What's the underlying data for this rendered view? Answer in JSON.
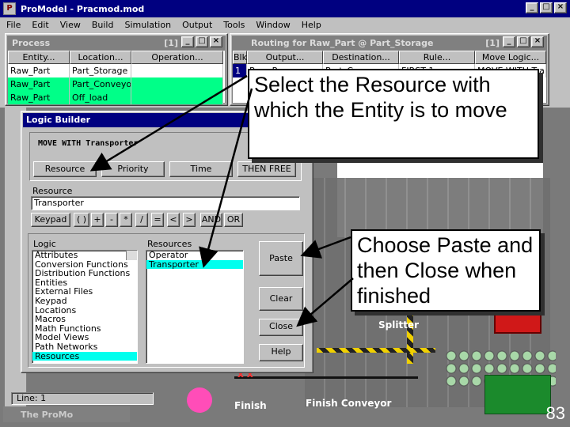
{
  "app": {
    "title": "ProModel - Pracmod.mod",
    "menu": [
      "File",
      "Edit",
      "View",
      "Build",
      "Simulation",
      "Output",
      "Tools",
      "Window",
      "Help"
    ]
  },
  "process": {
    "title": "Process",
    "count": "[1]",
    "columns": [
      "Entity...",
      "Location...",
      "Operation..."
    ],
    "rows": [
      [
        "Raw_Part",
        "Part_Storage",
        ""
      ],
      [
        "Raw_Part",
        "Part_Conveyor",
        ""
      ],
      [
        "Raw_Part",
        "Off_load",
        ""
      ]
    ]
  },
  "routing": {
    "title": "Routing for Raw_Part @ Part_Storage",
    "count": "[1]",
    "columns": [
      "Blk",
      "Output...",
      "Destination...",
      "Rule...",
      "Move Logic..."
    ],
    "row": [
      "1",
      "Raw_P",
      "Part_Conve",
      "FIRST 1",
      "MOVE WITH Tra"
    ]
  },
  "logic_builder": {
    "title": "Logic Builder",
    "statement": "MOVE WITH Transporter",
    "param_buttons": [
      "Resource",
      "Priority",
      "Time",
      "THEN FREE"
    ],
    "field_label": "Resource",
    "field_value": "Transporter",
    "keypad_label": "Keypad",
    "keypad_keys": [
      "( )",
      "+",
      "-",
      "*",
      "/",
      "=",
      "<",
      ">",
      "AND",
      "OR"
    ],
    "logic_header": "Logic",
    "logic_items": [
      "Attributes",
      "Conversion Functions",
      "Distribution Functions",
      "Entities",
      "External Files",
      "Keypad",
      "Locations",
      "Macros",
      "Math Functions",
      "Model Views",
      "Path Networks",
      "Resources"
    ],
    "resources_header": "Resources",
    "resource_items": [
      "Operator",
      "Transporter"
    ],
    "buttons": {
      "paste": "Paste",
      "clear": "Clear",
      "close": "Close",
      "help": "Help"
    }
  },
  "layout": {
    "splitter": "Splitter",
    "finish": "Finish",
    "finish_conveyor": "Finish Conveyor",
    "marks": "x x"
  },
  "status": {
    "line": "Line: 1"
  },
  "taskbar": {
    "item": "The ProMo"
  },
  "callouts": {
    "top": "Select the Resource with which the Entity is to move",
    "bottom": "Choose Paste and then Close when finished"
  },
  "page_number": "83",
  "colors": {
    "highlight_row": "#00ff88",
    "selection": "#00ffee",
    "titlebar": "#000080"
  }
}
